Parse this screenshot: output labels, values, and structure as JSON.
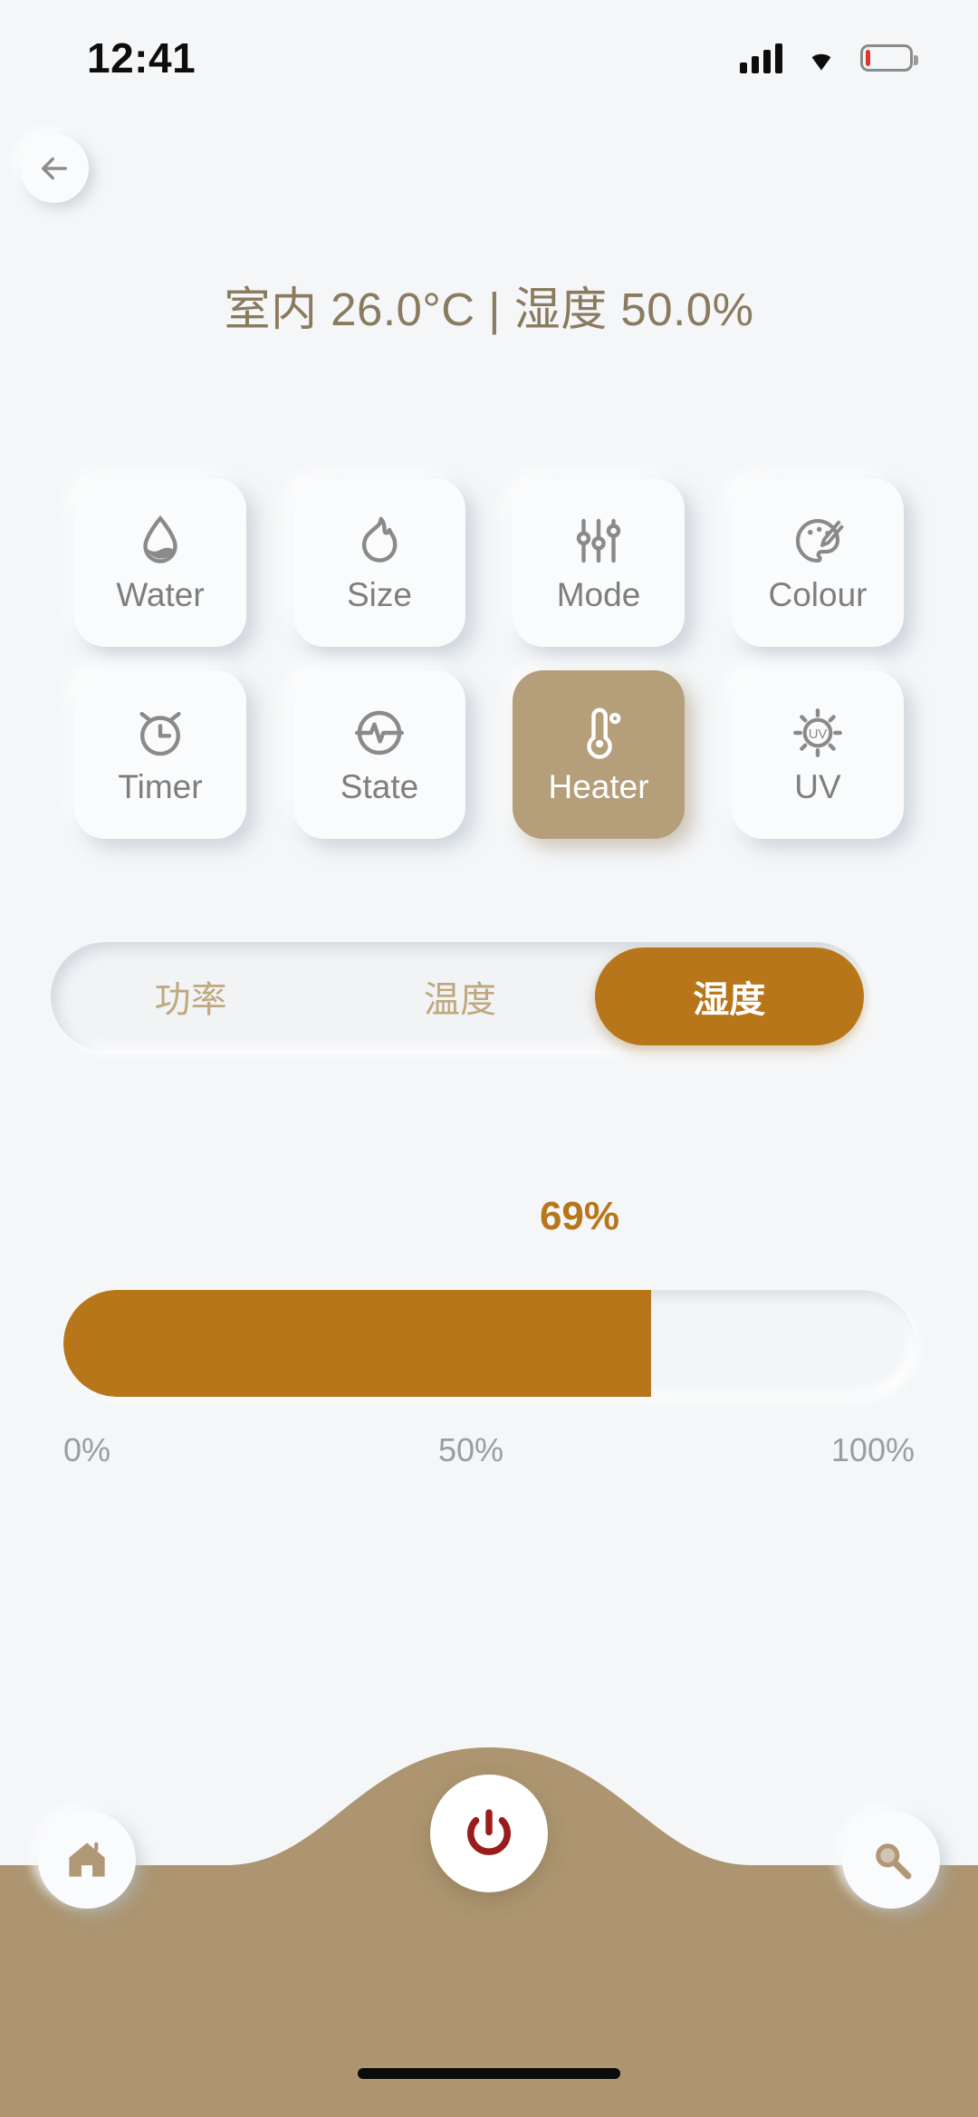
{
  "status_bar": {
    "time": "12:41",
    "signal_icon": "cellular-signal-icon",
    "wifi_icon": "wifi-icon",
    "battery_icon": "battery-low-icon",
    "battery_color": "#e0342c"
  },
  "nav": {
    "back_icon": "arrow-left-icon"
  },
  "header": {
    "title": "室内 26.0°C | 湿度 50.0%",
    "title_color": "#8a7a5e"
  },
  "controls": [
    {
      "label": "Water",
      "icon": "water-drop-icon",
      "active": false
    },
    {
      "label": "Size",
      "icon": "flame-icon",
      "active": false
    },
    {
      "label": "Mode",
      "icon": "sliders-icon",
      "active": false
    },
    {
      "label": "Colour",
      "icon": "palette-icon",
      "active": false
    },
    {
      "label": "Timer",
      "icon": "alarm-clock-icon",
      "active": false
    },
    {
      "label": "State",
      "icon": "pulse-circle-icon",
      "active": false
    },
    {
      "label": "Heater",
      "icon": "thermometer-icon",
      "active": true
    },
    {
      "label": "UV",
      "icon": "uv-sun-icon",
      "active": false
    }
  ],
  "segmented": {
    "options": [
      {
        "label": "功率",
        "selected": false
      },
      {
        "label": "温度",
        "selected": false
      },
      {
        "label": "湿度",
        "selected": true
      }
    ],
    "selected_color": "#b7761a",
    "inactive_text_color": "#c0a87e"
  },
  "slider": {
    "value_label": "69%",
    "value": 69,
    "min": 0,
    "max": 100,
    "fill_color": "#b7761a",
    "scale": [
      "0%",
      "50%",
      "100%"
    ]
  },
  "bottom_bar": {
    "background_color": "#ac9570",
    "home_icon": "home-icon",
    "power_icon": "power-icon",
    "power_icon_color": "#9b1c1c",
    "search_icon": "search-icon"
  }
}
